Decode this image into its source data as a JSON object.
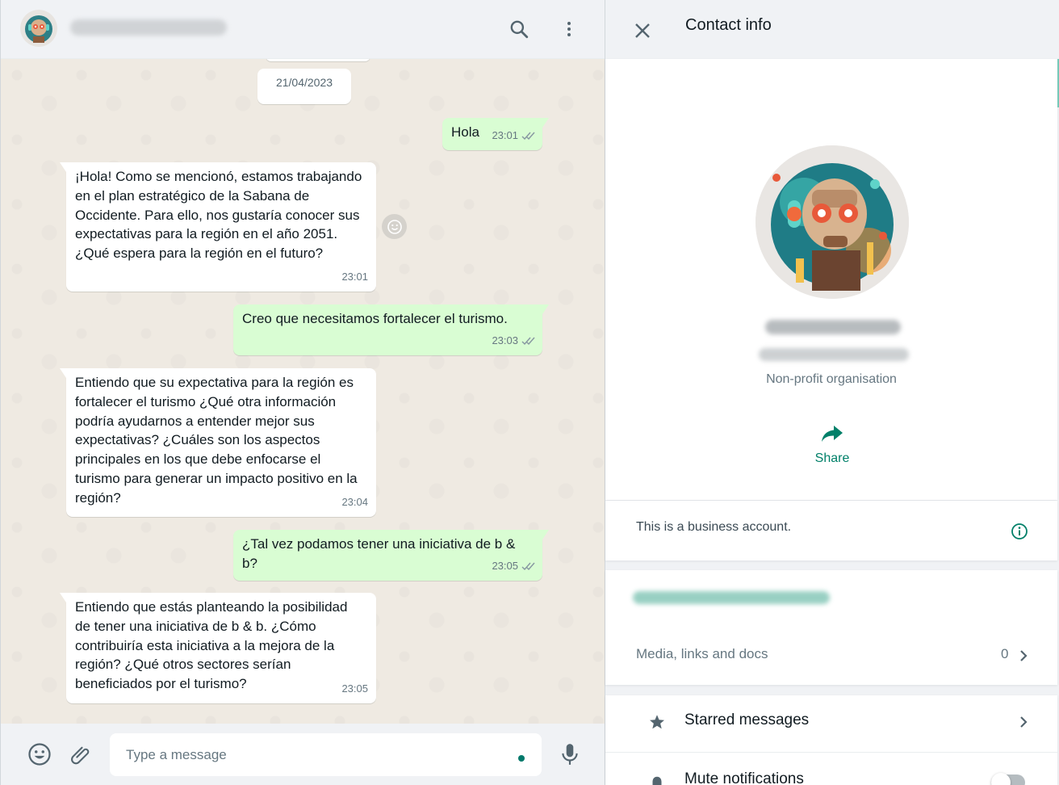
{
  "chat": {
    "date_chip": "21/04/2023",
    "messages": [
      {
        "direction": "out",
        "text": "Hola",
        "time": "23:01",
        "status": "read"
      },
      {
        "direction": "in",
        "text": "¡Hola! Como se mencionó, estamos trabajando en el plan estratégico de la Sabana de Occidente. Para ello, nos gustaría conocer sus expectativas para la región en el año 2051. ¿Qué espera para la región en el futuro?",
        "time": "23:01"
      },
      {
        "direction": "out",
        "text": "Creo que necesitamos fortalecer el turismo.",
        "time": "23:03",
        "status": "read"
      },
      {
        "direction": "in",
        "text": "Entiendo que su expectativa para la región es fortalecer el turismo ¿Qué otra información podría ayudarnos a entender mejor sus expectativas?  ¿Cuáles son los aspectos principales en los que debe enfocarse el turismo para generar un impacto positivo en la región?",
        "time": "23:04"
      },
      {
        "direction": "out",
        "text": "¿Tal vez podamos tener una iniciativa de b & b?",
        "time": "23:05",
        "status": "read"
      },
      {
        "direction": "in",
        "text": "Entiendo que estás planteando la posibilidad de tener una iniciativa de b & b. ¿Cómo contribuiría esta iniciativa a la mejora de la región? ¿Qué otros sectores serían beneficiados por el turismo?",
        "time": "23:05"
      }
    ],
    "composer": {
      "placeholder": "Type a message"
    },
    "icons": {
      "search": "search-icon",
      "menu": "menu-icon",
      "emoji": "emoji-icon",
      "attach": "attach-icon",
      "mic": "mic-icon",
      "react": "emoji-react-icon"
    }
  },
  "contact_info": {
    "title": "Contact info",
    "category": "Non-profit organisation",
    "share_label": "Share",
    "business_notice": "This is a business account.",
    "media_label": "Media, links and docs",
    "media_count": "0",
    "starred_label": "Starred messages",
    "mute_label": "Mute notifications",
    "mute_enabled": false
  },
  "colors": {
    "accent": "#008069",
    "outgoing_bubble": "#d9fdd3",
    "incoming_bubble": "#ffffff",
    "chat_background": "#efeae2",
    "panel_background": "#f0f2f5"
  }
}
